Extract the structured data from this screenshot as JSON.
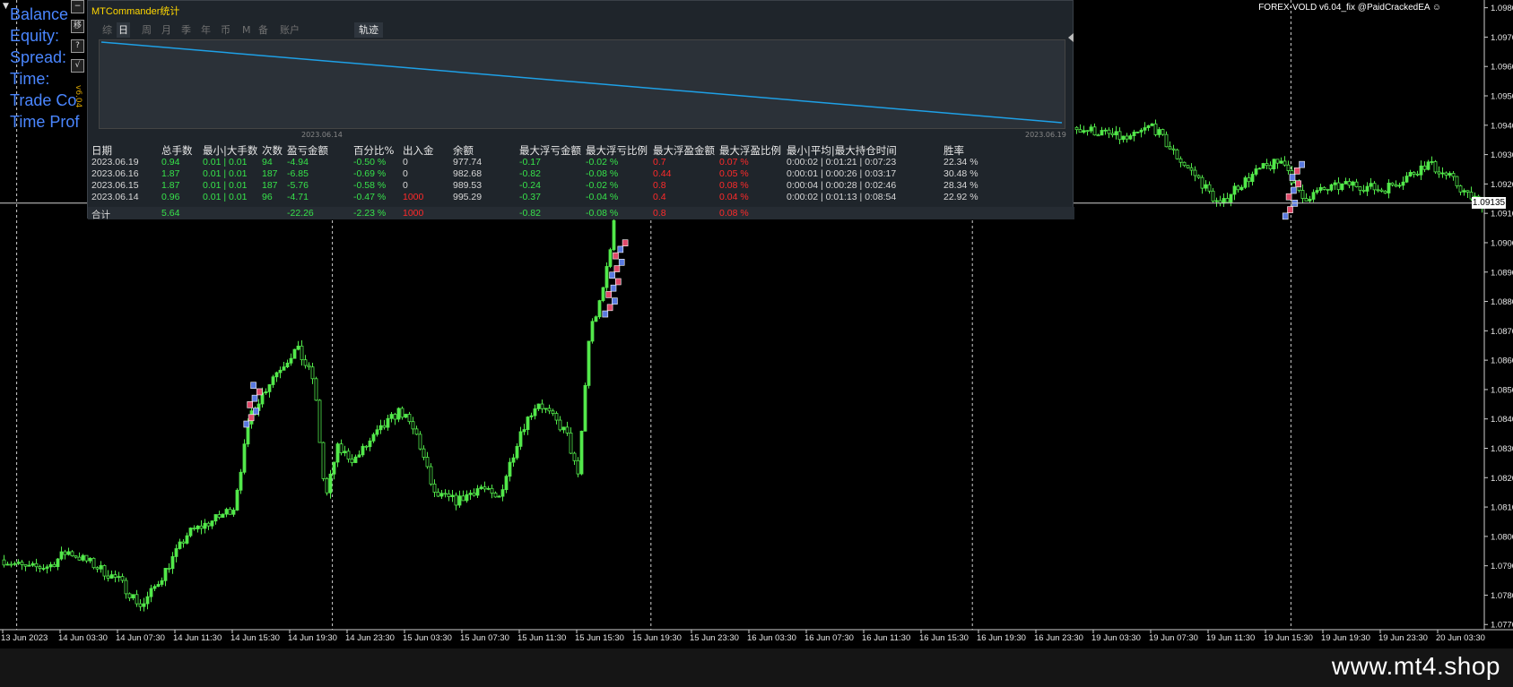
{
  "window": {
    "symbol_label": "FOREX-VOLD",
    "version_label": "v6.04_fix",
    "handle_label": "@PaidCrackedEA",
    "watermark": "www.mt4.shop"
  },
  "hud": {
    "lines": [
      "Balance",
      "Equity:",
      "Spread:",
      "Time:",
      "Trade Co",
      "Time Prof"
    ],
    "side_buttons": [
      "−",
      "移",
      "?",
      "√"
    ],
    "vertical_text": "v6.04"
  },
  "current_price": "1.09135",
  "panel": {
    "title": "MTCommander统计",
    "tabs": [
      "综",
      "日",
      "周",
      "月",
      "季",
      "年",
      "币",
      "M",
      "备",
      "账户"
    ],
    "active_tab": "日",
    "track_tab": "轨迹",
    "equity_curve": {
      "start_label": "2023.06.14",
      "end_label": "2023.06.19",
      "start_value": 1000,
      "end_value": 977.74
    },
    "headers": [
      "日期",
      "总手数",
      "最小|大手数",
      "次数",
      "盈亏金额",
      "百分比%",
      "出入金",
      "余额",
      "最大浮亏金额",
      "最大浮亏比例",
      "最大浮盈金额",
      "最大浮盈比例",
      "最小|平均|最大持仓时间",
      "胜率"
    ],
    "rows": [
      [
        "2023.06.19",
        "0.94",
        "0.01 | 0.01",
        "94",
        "-4.94",
        "-0.50 %",
        "0",
        "977.74",
        "-0.17",
        "-0.02 %",
        "0.7",
        "0.07 %",
        "0:00:02 | 0:01:21 | 0:07:23",
        "22.34 %"
      ],
      [
        "2023.06.16",
        "1.87",
        "0.01 | 0.01",
        "187",
        "-6.85",
        "-0.69 %",
        "0",
        "982.68",
        "-0.82",
        "-0.08 %",
        "0.44",
        "0.05 %",
        "0:00:01 | 0:00:26 | 0:03:17",
        "30.48 %"
      ],
      [
        "2023.06.15",
        "1.87",
        "0.01 | 0.01",
        "187",
        "-5.76",
        "-0.58 %",
        "0",
        "989.53",
        "-0.24",
        "-0.02 %",
        "0.8",
        "0.08 %",
        "0:00:04 | 0:00:28 | 0:02:46",
        "28.34 %"
      ],
      [
        "2023.06.14",
        "0.96",
        "0.01 | 0.01",
        "96",
        "-4.71",
        "-0.47 %",
        "1000",
        "995.29",
        "-0.37",
        "-0.04 %",
        "0.4",
        "0.04 %",
        "0:00:02 | 0:01:13 | 0:08:54",
        "22.92 %"
      ]
    ],
    "total": [
      "合计",
      "5.64",
      "",
      "",
      "-22.26",
      "-2.23 %",
      "1000",
      "",
      "-0.82",
      "-0.08 %",
      "0.8",
      "0.08 %",
      "",
      ""
    ]
  },
  "chart_data": {
    "type": "line",
    "title": "",
    "y_ticks": [
      "1.09800",
      "1.09700",
      "1.09600",
      "1.09500",
      "1.09400",
      "1.09300",
      "1.09200",
      "1.09100",
      "1.09000",
      "1.08900",
      "1.08800",
      "1.08700",
      "1.08600",
      "1.08500",
      "1.08400",
      "1.08300",
      "1.08200",
      "1.08100",
      "1.08000",
      "1.07900",
      "1.07800",
      "1.07700"
    ],
    "ylim": [
      1.07655,
      1.09805
    ],
    "x_ticks": [
      "13 Jun 2023",
      "14 Jun 03:30",
      "14 Jun 07:30",
      "14 Jun 11:30",
      "14 Jun 15:30",
      "14 Jun 19:30",
      "14 Jun 23:30",
      "15 Jun 03:30",
      "15 Jun 07:30",
      "15 Jun 11:30",
      "15 Jun 15:30",
      "15 Jun 19:30",
      "15 Jun 23:30",
      "16 Jun 03:30",
      "16 Jun 07:30",
      "16 Jun 11:30",
      "16 Jun 15:30",
      "16 Jun 19:30",
      "16 Jun 23:30",
      "19 Jun 03:30",
      "19 Jun 07:30",
      "19 Jun 11:30",
      "19 Jun 15:30",
      "19 Jun 19:30",
      "19 Jun 23:30",
      "20 Jun 03:30"
    ],
    "day_separators": [
      "14 Jun",
      "15 Jun",
      "16 Jun",
      "19 Jun",
      "20 Jun"
    ],
    "price_path": [
      {
        "t": 0,
        "p": 1.0792
      },
      {
        "t": 0.4,
        "p": 1.0789
      },
      {
        "t": 0.8,
        "p": 1.079
      },
      {
        "t": 1.1,
        "p": 1.0795
      },
      {
        "t": 1.5,
        "p": 1.0791
      },
      {
        "t": 2.0,
        "p": 1.0785
      },
      {
        "t": 2.4,
        "p": 1.0776
      },
      {
        "t": 2.8,
        "p": 1.0788
      },
      {
        "t": 3.2,
        "p": 1.0801
      },
      {
        "t": 3.7,
        "p": 1.0806
      },
      {
        "t": 4.0,
        "p": 1.081
      },
      {
        "t": 4.3,
        "p": 1.0842
      },
      {
        "t": 4.7,
        "p": 1.0855
      },
      {
        "t": 5.1,
        "p": 1.0864
      },
      {
        "t": 5.4,
        "p": 1.0853
      },
      {
        "t": 5.6,
        "p": 1.0812
      },
      {
        "t": 5.8,
        "p": 1.083
      },
      {
        "t": 6.1,
        "p": 1.0826
      },
      {
        "t": 6.5,
        "p": 1.0835
      },
      {
        "t": 6.9,
        "p": 1.0843
      },
      {
        "t": 7.2,
        "p": 1.0834
      },
      {
        "t": 7.5,
        "p": 1.0814
      },
      {
        "t": 7.9,
        "p": 1.0812
      },
      {
        "t": 8.3,
        "p": 1.0817
      },
      {
        "t": 8.6,
        "p": 1.0812
      },
      {
        "t": 9.0,
        "p": 1.0836
      },
      {
        "t": 9.3,
        "p": 1.0846
      },
      {
        "t": 9.8,
        "p": 1.0835
      },
      {
        "t": 10.0,
        "p": 1.082
      },
      {
        "t": 10.2,
        "p": 1.087
      },
      {
        "t": 10.4,
        "p": 1.088
      },
      {
        "t": 10.7,
        "p": 1.0915
      },
      {
        "t": 18.0,
        "p": 1.0945
      },
      {
        "t": 18.4,
        "p": 1.094
      },
      {
        "t": 19.0,
        "p": 1.0938
      },
      {
        "t": 19.6,
        "p": 1.0935
      },
      {
        "t": 20.0,
        "p": 1.094
      },
      {
        "t": 20.4,
        "p": 1.093
      },
      {
        "t": 20.8,
        "p": 1.0922
      },
      {
        "t": 21.2,
        "p": 1.0912
      },
      {
        "t": 21.4,
        "p": 1.0918
      },
      {
        "t": 21.9,
        "p": 1.0925
      },
      {
        "t": 22.3,
        "p": 1.0928
      },
      {
        "t": 22.6,
        "p": 1.0915
      },
      {
        "t": 23.0,
        "p": 1.0918
      },
      {
        "t": 23.5,
        "p": 1.092
      },
      {
        "t": 24.0,
        "p": 1.0918
      },
      {
        "t": 24.4,
        "p": 1.0922
      },
      {
        "t": 24.8,
        "p": 1.0927
      },
      {
        "t": 25.2,
        "p": 1.0922
      },
      {
        "t": 25.5,
        "p": 1.0916
      },
      {
        "t": 25.8,
        "p": 1.09135
      }
    ]
  },
  "colors": {
    "background": "#000000",
    "candle": "#52e84a",
    "hud_text": "#4a86ff",
    "panel_bg": "#1f252b",
    "equity_line": "#1ea0e6",
    "profit": "#37e24a",
    "loss": "#ff2a2a",
    "grid_separator": "#cfcfcf",
    "axis": "#cfcfcf"
  }
}
